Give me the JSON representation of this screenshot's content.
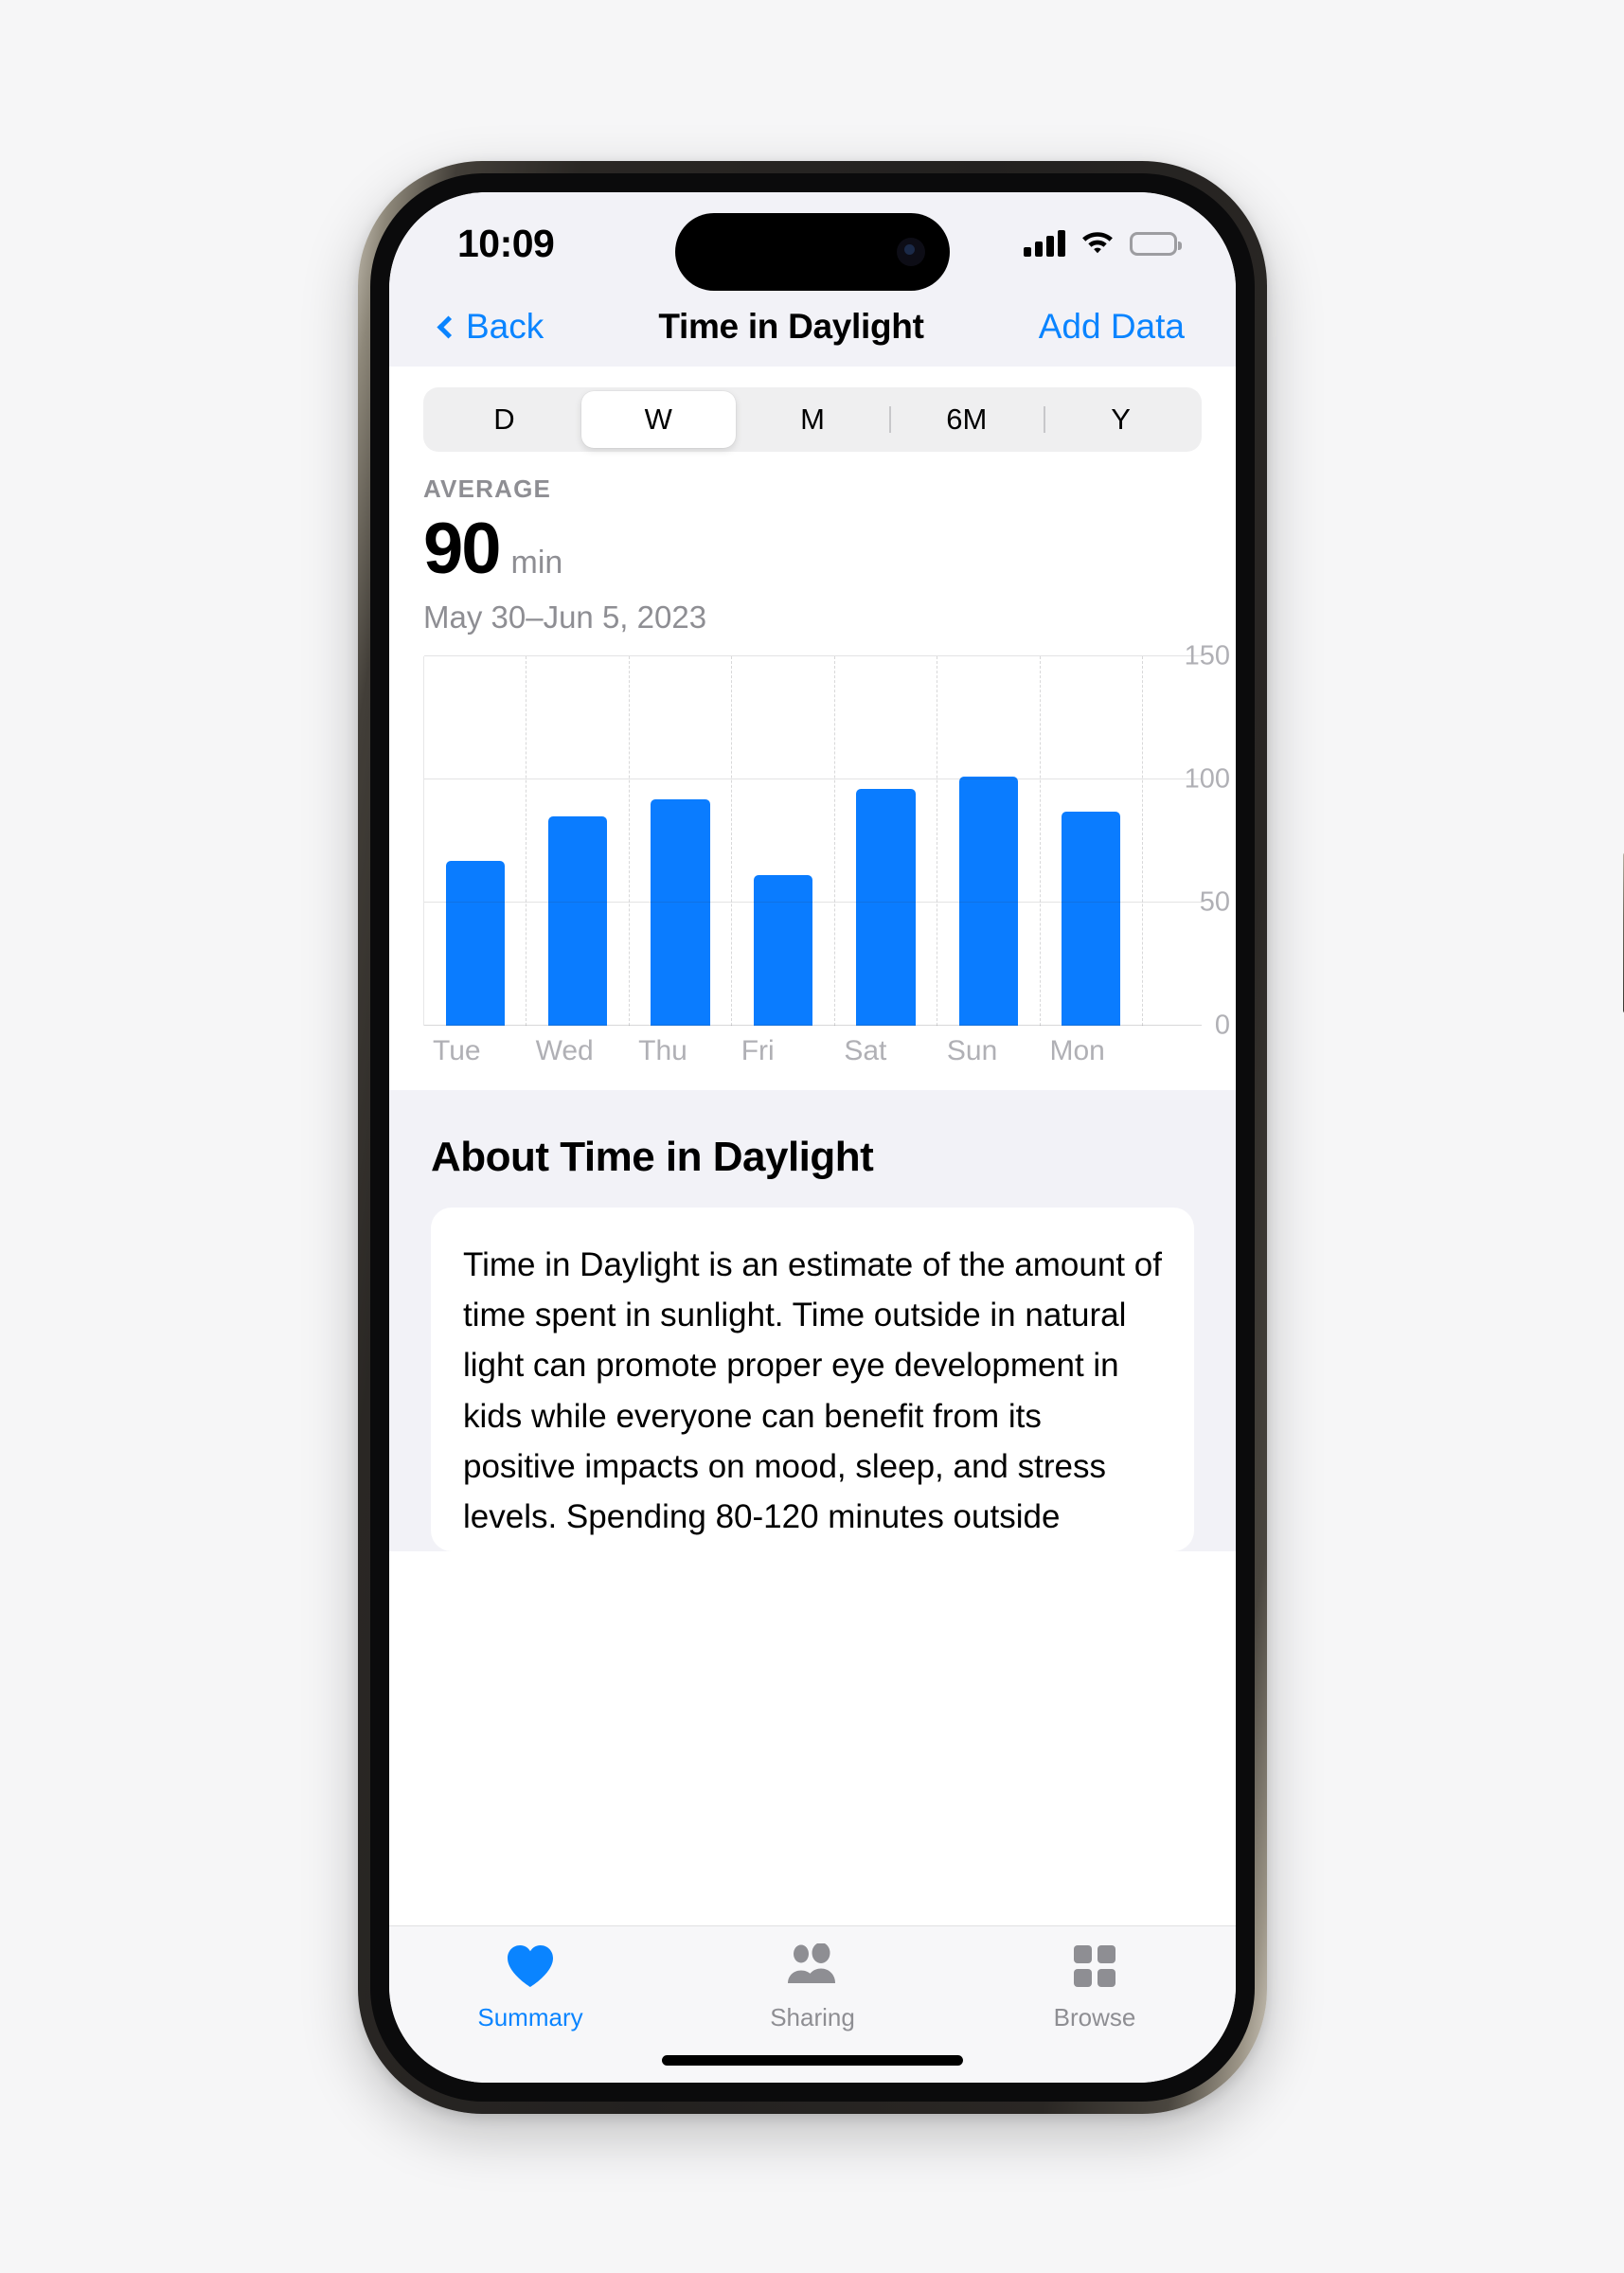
{
  "status_bar": {
    "time": "10:09",
    "signal_icon": "cellular-bars-icon",
    "wifi_icon": "wifi-icon",
    "battery_icon": "battery-full-icon"
  },
  "nav": {
    "back_label": "Back",
    "title": "Time in Daylight",
    "action_label": "Add Data"
  },
  "segmented": {
    "selected": "W",
    "options": [
      {
        "label": "D"
      },
      {
        "label": "W"
      },
      {
        "label": "M"
      },
      {
        "label": "6M"
      },
      {
        "label": "Y"
      }
    ]
  },
  "summary": {
    "label": "AVERAGE",
    "value": "90",
    "unit": "min",
    "range": "May 30–Jun 5, 2023"
  },
  "chart_data": {
    "type": "bar",
    "title": "Time in Daylight",
    "xlabel": "",
    "ylabel": "min",
    "categories": [
      "Tue",
      "Wed",
      "Thu",
      "Fri",
      "Sat",
      "Sun",
      "Mon"
    ],
    "values": [
      67,
      85,
      92,
      61,
      96,
      101,
      87
    ],
    "yticks": [
      0,
      50,
      100,
      150
    ],
    "ytick_labels": [
      "0",
      "50",
      "100",
      "150"
    ],
    "ylim": [
      0,
      150
    ],
    "grid": true,
    "legend": "none",
    "bar_color": "#0a7cff",
    "average_line": 90,
    "date_range": "May 30–Jun 5, 2023"
  },
  "about": {
    "title": "About Time in Daylight",
    "body": "Time in Daylight is an estimate of the amount of time spent in sunlight. Time outside in natural light can promote proper eye development in kids while everyone can benefit from its positive impacts on mood, sleep, and stress levels. Spending 80-120 minutes outside"
  },
  "tabbar": {
    "items": [
      {
        "label": "Summary",
        "icon": "heart-icon",
        "active": true
      },
      {
        "label": "Sharing",
        "icon": "people-icon",
        "active": false
      },
      {
        "label": "Browse",
        "icon": "grid-icon",
        "active": false
      }
    ]
  },
  "colors": {
    "accent": "#0a84ff",
    "bar": "#0a7cff",
    "secondary_text": "#8e8e93",
    "group_bg": "#f2f2f7"
  }
}
